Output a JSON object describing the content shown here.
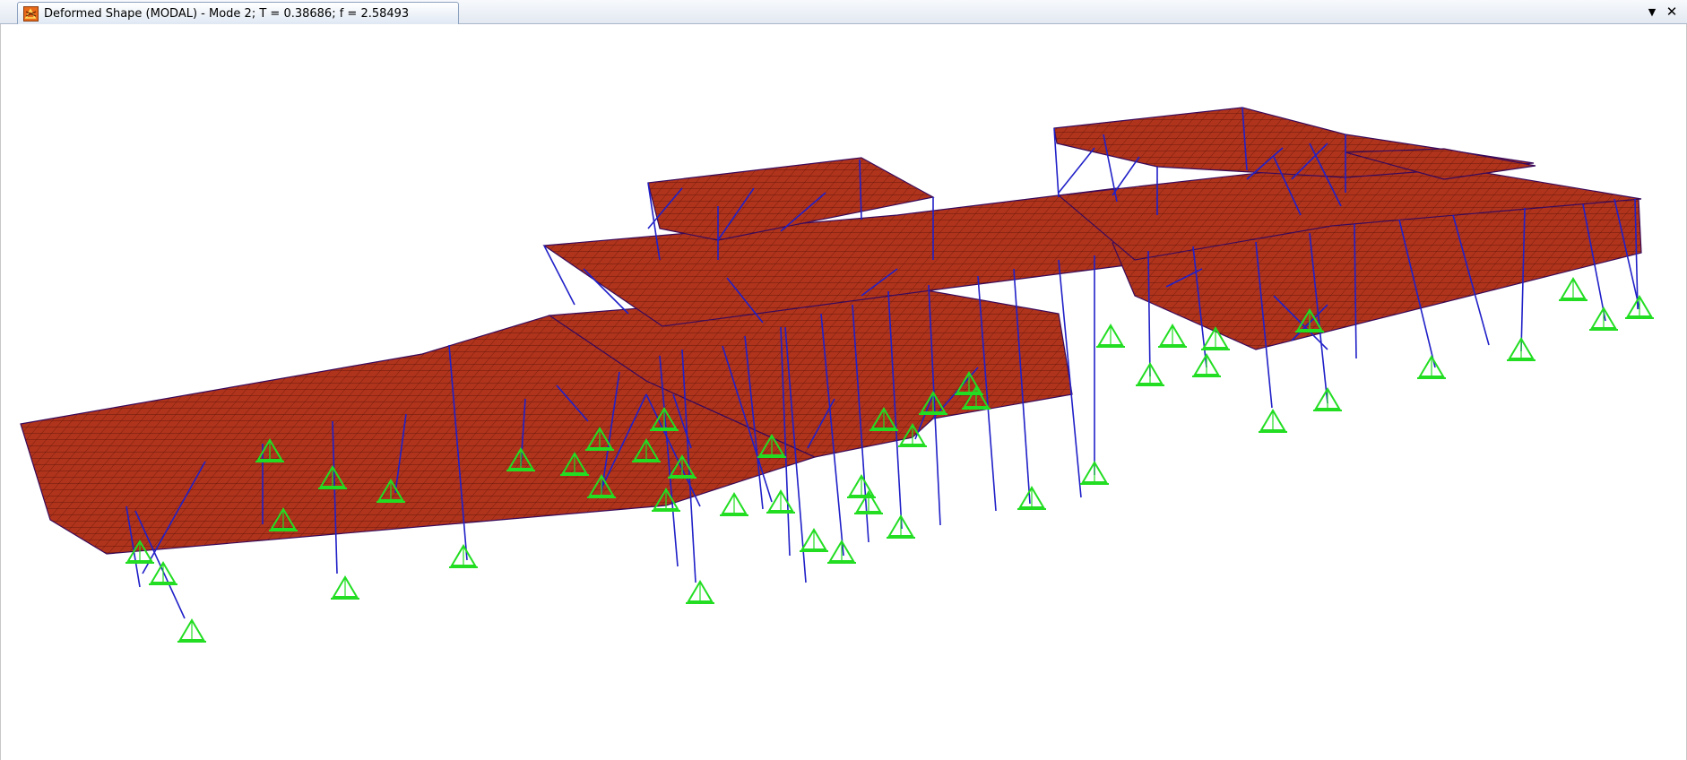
{
  "window": {
    "tab_title": "Deformed Shape (MODAL) - Mode 2; T = 0.38686;  f = 2.58493",
    "dropdown_glyph": "▼",
    "close_glyph": "✕"
  },
  "icons": {
    "tab_icon": "sap-model-icon",
    "dropdown": "chevron-down-icon",
    "close": "close-icon",
    "support": "pinned-support-icon"
  },
  "colors": {
    "slab_fill": "#b0341c",
    "slab_grid": "#5a1208",
    "frame": "#2020c8",
    "support": "#22dd22",
    "tab_icon_bg": "#e86a1a"
  }
}
